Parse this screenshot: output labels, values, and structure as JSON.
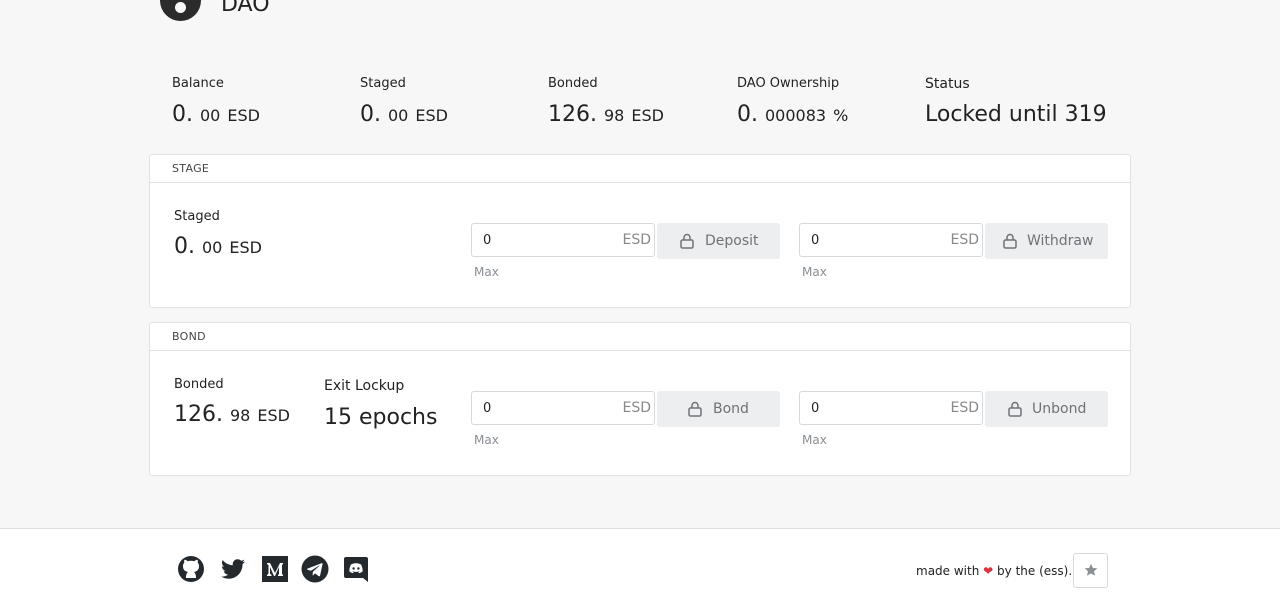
{
  "header": {
    "title": "DAO"
  },
  "stats": [
    {
      "label": "Balance",
      "int": "0.",
      "dec": "00",
      "unit": "ESD"
    },
    {
      "label": "Staged",
      "int": "0.",
      "dec": "00",
      "unit": "ESD"
    },
    {
      "label": "Bonded",
      "int": "126.",
      "dec": "98",
      "unit": "ESD"
    },
    {
      "label": "DAO Ownership",
      "int": "0.",
      "dec": "000083",
      "unit": "%"
    },
    {
      "label": "Status",
      "value": "Locked until 319"
    }
  ],
  "stage": {
    "header": "STAGE",
    "staged_label": "Staged",
    "staged_int": "0.",
    "staged_dec": "00",
    "staged_unit": "ESD",
    "deposit": {
      "value": "0",
      "unit": "ESD",
      "button": "Deposit",
      "max": "Max"
    },
    "withdraw": {
      "value": "0",
      "unit": "ESD",
      "button": "Withdraw",
      "max": "Max"
    }
  },
  "bond": {
    "header": "BOND",
    "bonded_label": "Bonded",
    "bonded_int": "126.",
    "bonded_dec": "98",
    "bonded_unit": "ESD",
    "exit_label": "Exit Lockup",
    "exit_value": "15 epochs",
    "bond": {
      "value": "0",
      "unit": "ESD",
      "button": "Bond",
      "max": "Max"
    },
    "unbond": {
      "value": "0",
      "unit": "ESD",
      "button": "Unbond",
      "max": "Max"
    }
  },
  "footer": {
    "made_with": "made with",
    "by_text": "by the (ess).",
    "social_icons": [
      "github-icon",
      "twitter-icon",
      "medium-icon",
      "telegram-icon",
      "discord-icon"
    ]
  },
  "colors": {
    "background": "#f7f7f8",
    "heart": "#d9343b",
    "button_bg": "#eceef0"
  }
}
